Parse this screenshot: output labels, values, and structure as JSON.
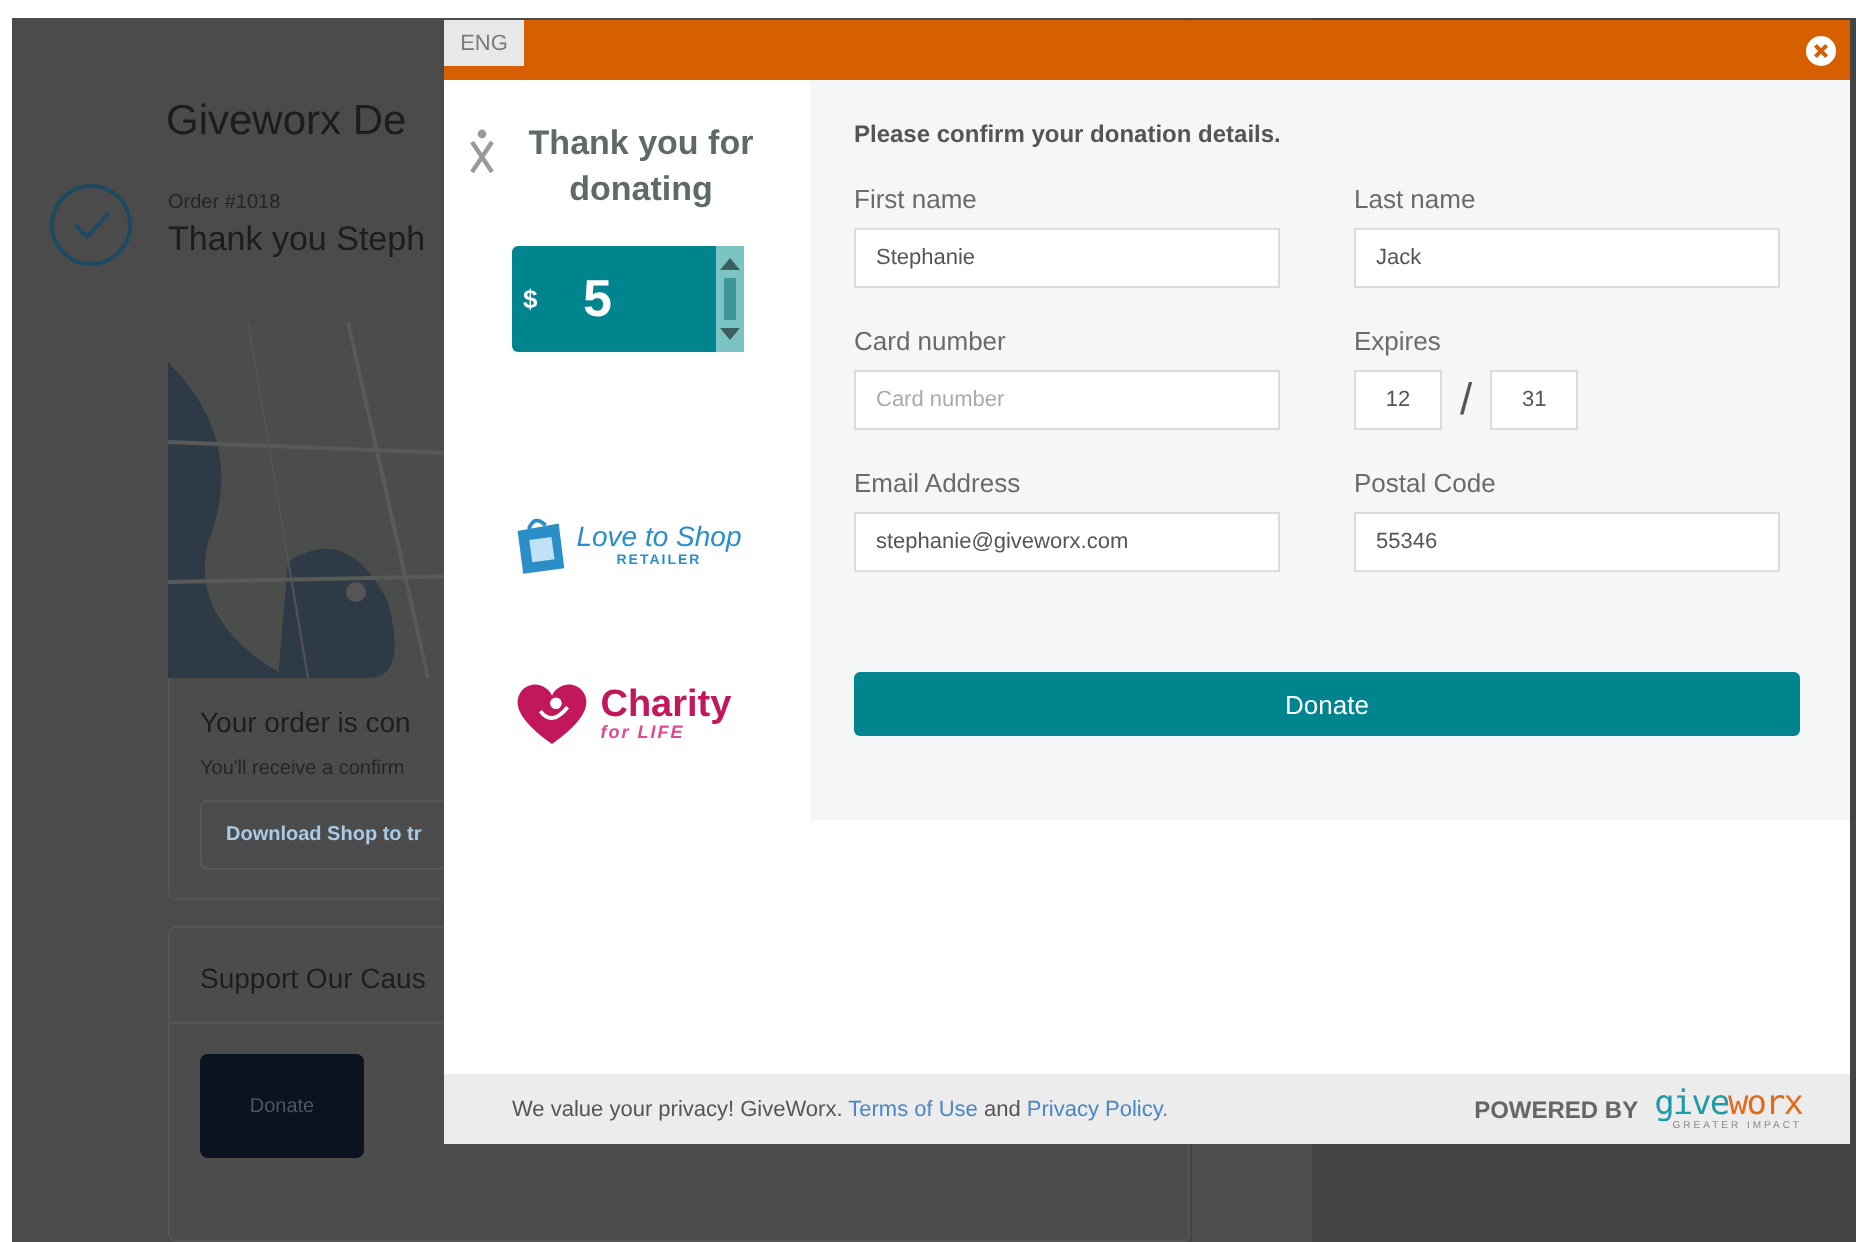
{
  "page": {
    "title": "Giveworx De",
    "order_number": "Order #1018",
    "greeting": "Thank you Steph",
    "order_card": {
      "heading": "Your order is con",
      "note": "You'll receive a confirm",
      "link": "Download Shop to tr"
    },
    "cause_card": {
      "heading": "Support Our Caus",
      "button": "Donate"
    }
  },
  "modal": {
    "language": "ENG",
    "sidebar": {
      "title": "Thank you for donating",
      "currency": "$",
      "amount": "5",
      "sponsors": [
        {
          "kind": "shop",
          "name": "Love to Shop",
          "tagline": "RETAILER"
        },
        {
          "kind": "charity",
          "name": "Charity",
          "tagline": "for LIFE"
        }
      ]
    },
    "form": {
      "heading": "Please confirm your donation details.",
      "fields": [
        {
          "kind": "text",
          "label": "First name",
          "value": "Stephanie"
        },
        {
          "kind": "text",
          "label": "Last name",
          "value": "Jack"
        },
        {
          "kind": "text",
          "label": "Card number",
          "placeholder": "Card number"
        },
        {
          "kind": "expiry",
          "label": "Expires",
          "month": "12",
          "separator": "/",
          "year": "31"
        },
        {
          "kind": "text",
          "label": "Email Address",
          "value": "stephanie@giveworx.com"
        },
        {
          "kind": "text",
          "label": "Postal Code",
          "value": "55346"
        }
      ],
      "submit": "Donate"
    },
    "footer": {
      "notice": "We value your privacy! GiveWorx.",
      "terms_link": "Terms of Use",
      "joiner": "and",
      "privacy_link": "Privacy Policy.",
      "powered_by": "POWERED BY",
      "brand": "giveworx",
      "brand_tagline": "GREATER IMPACT"
    }
  }
}
